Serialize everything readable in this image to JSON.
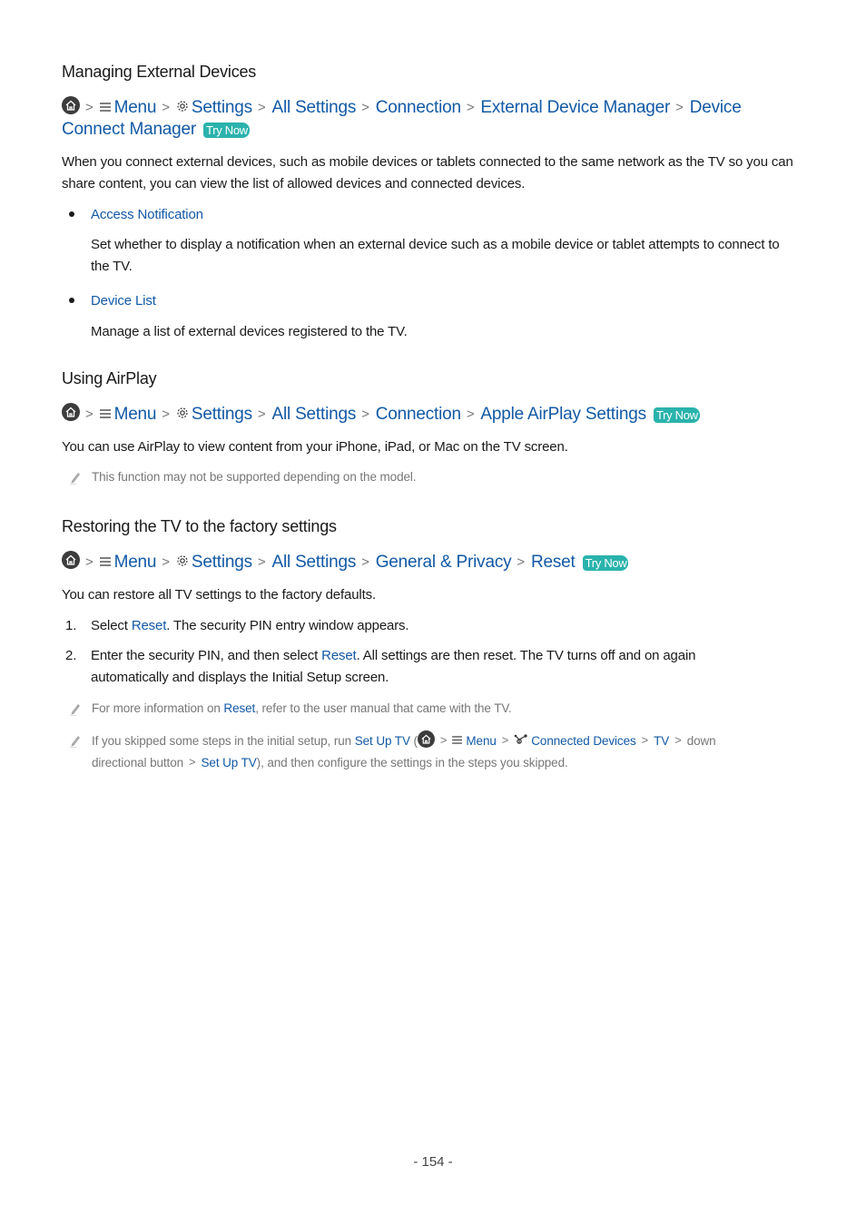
{
  "sections": [
    {
      "title": "Managing External Devices",
      "path": {
        "home": "home-icon",
        "items": [
          "Menu",
          "Settings",
          "All Settings",
          "Connection",
          "External Device Manager",
          "Device Connect Manager"
        ],
        "try_now": "Try Now"
      },
      "intro": "When you connect external devices, such as mobile devices or tablets connected to the same network as the TV so you can share content, you can view the list of allowed devices and connected devices.",
      "bullets": [
        {
          "label": "Access Notification",
          "desc": "Set whether to display a notification when an external device such as a mobile device or tablet attempts to connect to the TV."
        },
        {
          "label": "Device List",
          "desc": "Manage a list of external devices registered to the TV."
        }
      ]
    },
    {
      "title": "Using AirPlay",
      "path": {
        "items": [
          "Menu",
          "Settings",
          "All Settings",
          "Connection",
          "Apple AirPlay Settings"
        ],
        "try_now": "Try Now"
      },
      "intro": "You can use AirPlay to view content from your iPhone, iPad, or Mac on the TV screen.",
      "note": "This function may not be supported depending on the model."
    },
    {
      "title": "Restoring the TV to the factory settings",
      "path": {
        "items": [
          "Menu",
          "Settings",
          "All Settings",
          "General & Privacy",
          "Reset"
        ],
        "try_now": "Try Now"
      },
      "intro": "You can restore all TV settings to the factory defaults.",
      "steps": [
        {
          "num": "1.",
          "pre": "Select ",
          "link": "Reset",
          "post": ". The security PIN entry window appears."
        },
        {
          "num": "2.",
          "pre": "Enter the security PIN, and then select ",
          "link": "Reset",
          "post": ". All settings are then reset. The TV turns off and on again automatically and displays the Initial Setup screen."
        }
      ],
      "notes": [
        {
          "pre": "For more information on ",
          "link": "Reset",
          "post": ", refer to the user manual that came with the TV."
        },
        {
          "pre": "If you skipped some steps in the initial setup, run ",
          "link1": "Set Up TV",
          "paren_open": " (",
          "menu": "Menu",
          "connected": "Connected Devices",
          "tv": "TV",
          "down": "down directional button",
          "link2": "Set Up TV",
          "post": "), and then configure the settings in the steps you skipped."
        }
      ]
    }
  ],
  "footer": {
    "page_number": "- 154 -"
  },
  "colors": {
    "link": "#1259a6",
    "try_now_bg": "#2ab3ac",
    "note_text": "#777777",
    "body_text": "#1a1a1a"
  }
}
